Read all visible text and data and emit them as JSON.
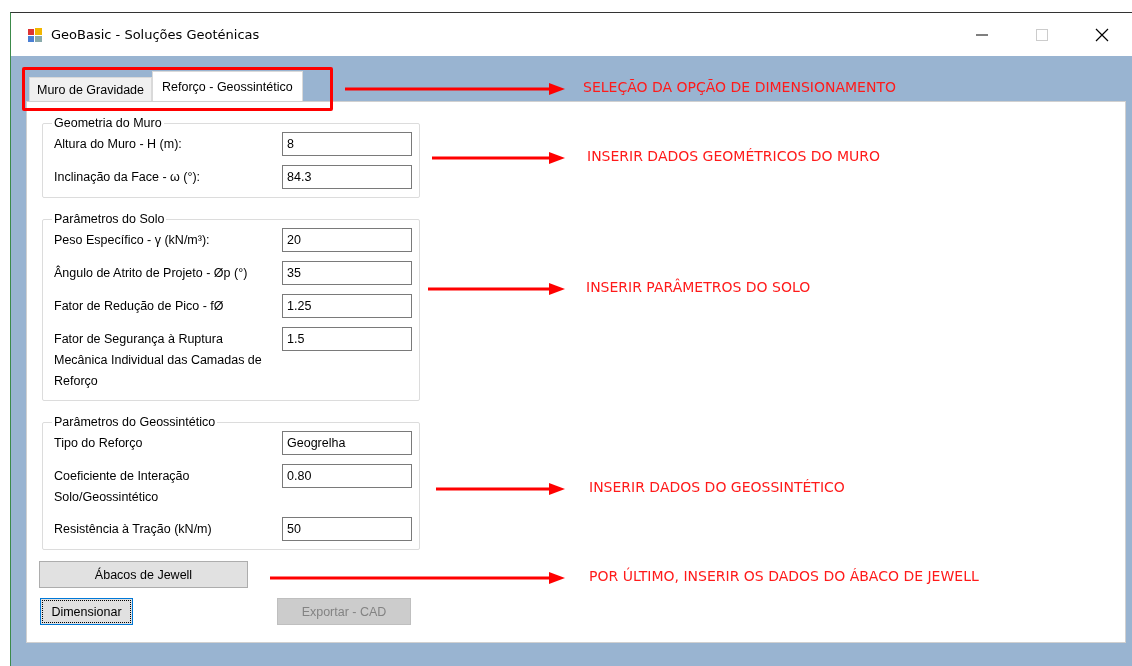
{
  "window": {
    "title": "GeoBasic - Soluções Geoténicas",
    "maximize_disabled": true
  },
  "tabs": [
    {
      "label": "Muro de Gravidade",
      "selected": false
    },
    {
      "label": "Reforço - Geossintético",
      "selected": true
    }
  ],
  "groups": [
    {
      "title": "Geometria do Muro",
      "fields": [
        {
          "label": "Altura do Muro - H (m):",
          "value": "8"
        },
        {
          "label": "Inclinação da Face - ω (°):",
          "value": "84.3"
        }
      ]
    },
    {
      "title": "Parâmetros do Solo",
      "fields": [
        {
          "label": "Peso Específico - γ (kN/m³):",
          "value": "20"
        },
        {
          "label": "Ângulo de Atrito de Projeto - Øp (°)",
          "value": "35"
        },
        {
          "label": "Fator de Redução de Pico - fØ",
          "value": "1.25"
        },
        {
          "label": "Fator de Segurança à Ruptura Mecânica Individual das Camadas de Reforço",
          "value": "1.5"
        }
      ]
    },
    {
      "title": "Parâmetros do Geossintético",
      "fields": [
        {
          "label": "Tipo do Reforço",
          "value": "Geogrelha"
        },
        {
          "label": "Coeficiente de Interação Solo/Geossintético",
          "value": "0.80"
        },
        {
          "label": "Resistência à Tração (kN/m)",
          "value": "50"
        }
      ]
    }
  ],
  "chart_button": {
    "label": "Ábacos de Jewell",
    "disabled": false
  },
  "actions": [
    {
      "label": "Dimensionar",
      "disabled": false,
      "focused": true
    },
    {
      "label": "Exportar - CAD",
      "disabled": true,
      "focused": false
    }
  ],
  "annotations": [
    {
      "text": "SELEÇÃO DA OPÇÃO DE DIMENSIONAMENTO"
    },
    {
      "text": "INSERIR DADOS GEOMÉTRICOS DO MURO"
    },
    {
      "text": "INSERIR PARÂMETROS DO SOLO"
    },
    {
      "text": "INSERIR DADOS DO GEOSSINTÉTICO"
    },
    {
      "text": "POR ÚLTIMO, INSERIR OS DADOS DO ÁBACO DE JEWELL"
    }
  ]
}
